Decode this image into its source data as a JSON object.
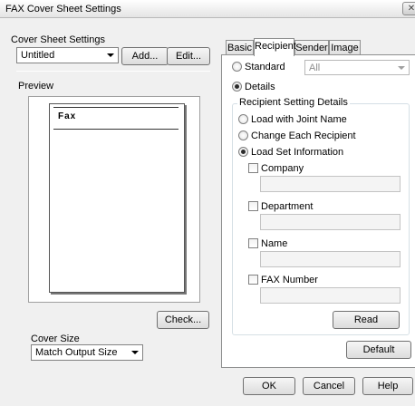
{
  "window": {
    "title": "FAX Cover Sheet Settings",
    "close_glyph": "✕"
  },
  "left": {
    "cover_sheet_settings_label": "Cover Sheet Settings",
    "cover_sheet_select_value": "Untitled",
    "add_button": "Add...",
    "edit_button": "Edit...",
    "preview_label": "Preview",
    "preview_paper_title": "Fax",
    "check_button": "Check...",
    "cover_size_label": "Cover Size",
    "cover_size_select_value": "Match Output Size"
  },
  "tabs": [
    {
      "label": "Basic",
      "active": false
    },
    {
      "label": "Recipient",
      "active": true
    },
    {
      "label": "Sender",
      "active": false
    },
    {
      "label": "Image",
      "active": false
    }
  ],
  "recipient": {
    "standard_label": "Standard",
    "standard_select_value": "All",
    "details_label": "Details",
    "group_title": "Recipient Setting Details",
    "load_joint_name_label": "Load with Joint Name",
    "change_each_label": "Change Each Recipient",
    "load_set_info_label": "Load Set Information",
    "company_label": "Company",
    "department_label": "Department",
    "name_label": "Name",
    "fax_number_label": "FAX Number",
    "read_button": "Read",
    "default_button": "Default",
    "selected_mode": "Details",
    "selected_detail": "Load Set Information"
  },
  "footer": {
    "ok_button": "OK",
    "cancel_button": "Cancel",
    "help_button": "Help"
  }
}
